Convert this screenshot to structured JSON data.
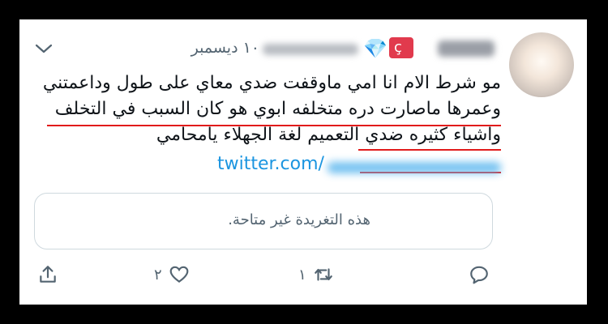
{
  "tweet": {
    "date": "١٠ ديسمبر",
    "flag_letter": "ç",
    "lines": [
      "مو شرط الام انا امي ماوقفت ضدي معاي على طول وداعمتني",
      "وعمرها ماصارت دره متخلفه ابوي هو كان السبب في التخلف",
      "واشياء كثيره ضدي التعميم لغة الجهلاء يامحامي"
    ],
    "link_prefix": "twitter.com/",
    "quoted_unavailable": "هذه التغريدة غير متاحة."
  },
  "actions": {
    "retweet_count": "١",
    "like_count": "٢"
  },
  "icons": [
    "chevron-down-icon",
    "diamond-icon",
    "reply-icon",
    "retweet-icon",
    "like-icon",
    "share-icon"
  ],
  "colors": {
    "link": "#1b95e0",
    "underline": "#e11b1b",
    "muted": "#536471",
    "text": "#0f1419"
  }
}
